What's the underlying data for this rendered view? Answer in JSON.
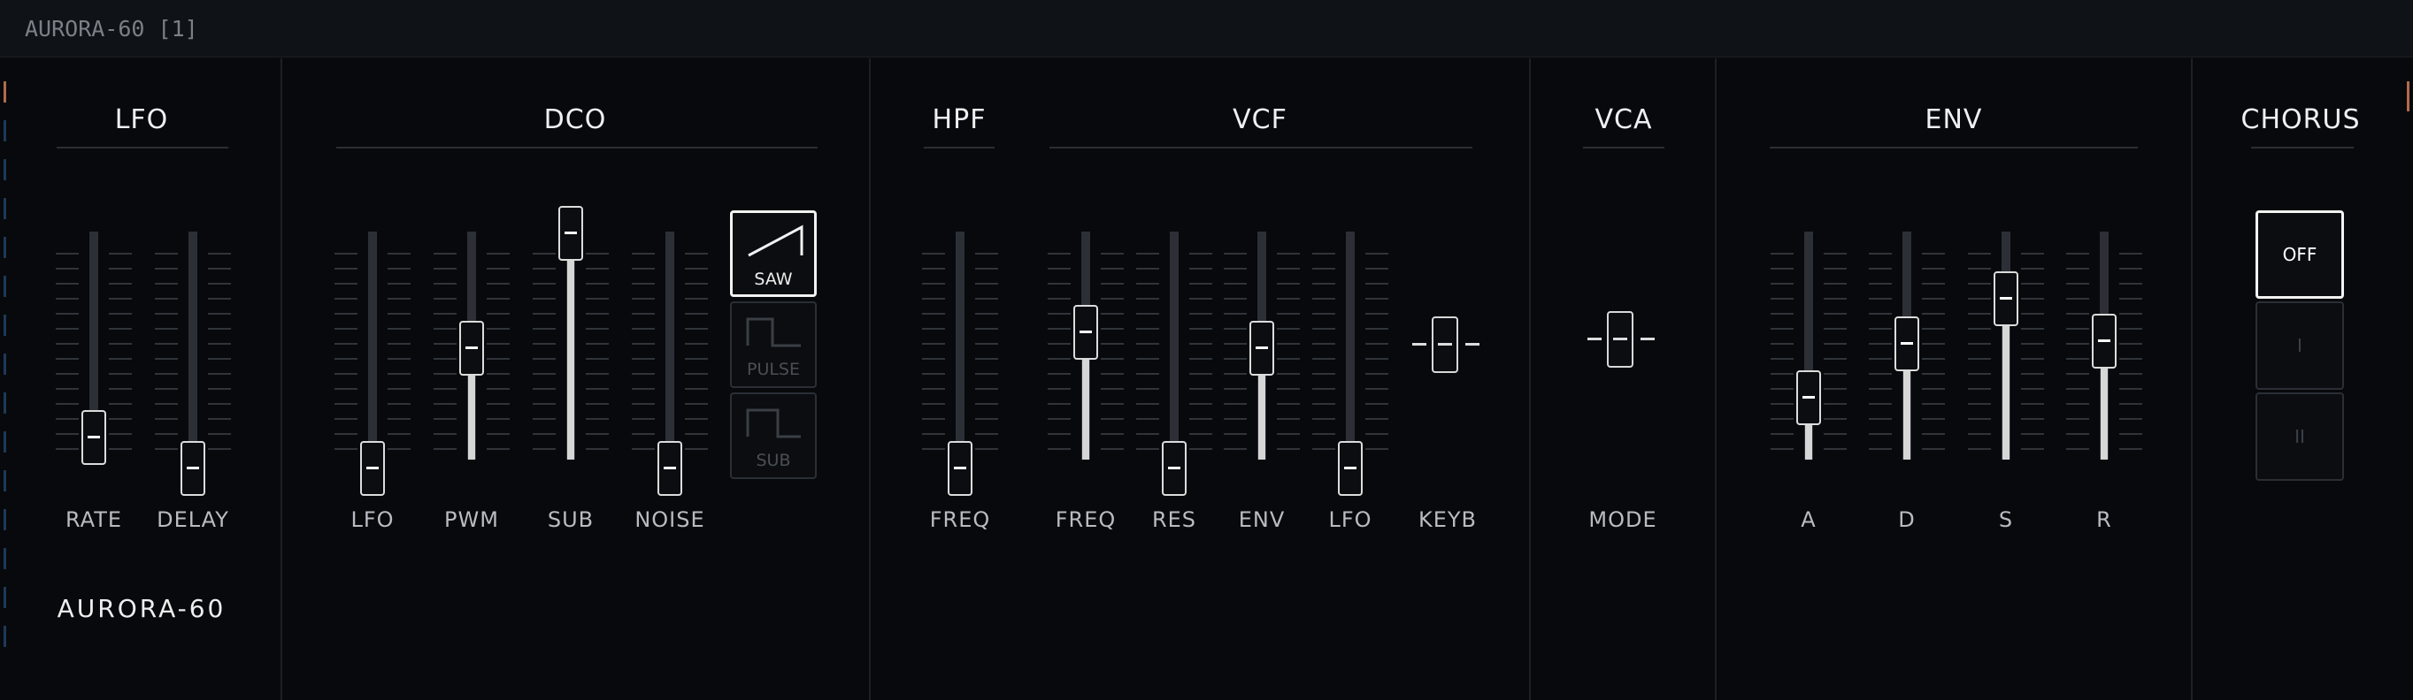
{
  "window": {
    "title": "AURORA-60 [1]"
  },
  "brand": "AURORA-60",
  "sections": {
    "lfo": "LFO",
    "dco": "DCO",
    "hpf": "HPF",
    "vcf": "VCF",
    "vca": "VCA",
    "env": "ENV",
    "chorus": "CHORUS"
  },
  "labels": {
    "rate": "RATE",
    "delay": "DELAY",
    "dco_lfo": "LFO",
    "pwm": "PWM",
    "sub": "SUB",
    "noise": "NOISE",
    "hpf_freq": "FREQ",
    "vcf_freq": "FREQ",
    "res": "RES",
    "env": "ENV",
    "vcf_lfo": "LFO",
    "keyb": "KEYB",
    "mode": "MODE",
    "a": "A",
    "d": "D",
    "s": "S",
    "r": "R"
  },
  "faders": {
    "rate": 0.13,
    "delay": 0.0,
    "dco_lfo": 0.0,
    "pwm": 0.51,
    "sub": 1.0,
    "noise": 0.0,
    "hpf_freq": 0.0,
    "vcf_freq": 0.58,
    "res": 0.0,
    "env": 0.51,
    "vcf_lfo": 0.0,
    "a": 0.3,
    "d": 0.53,
    "s": 0.72,
    "r": 0.54
  },
  "waveforms": {
    "saw": {
      "label": "SAW",
      "active": true
    },
    "pulse": {
      "label": "PULSE",
      "active": false
    },
    "sub": {
      "label": "SUB",
      "active": false
    }
  },
  "chorus": {
    "off": {
      "label": "OFF",
      "active": true
    },
    "one": {
      "label": "I",
      "active": false
    },
    "two": {
      "label": "II",
      "active": false
    }
  },
  "switches": {
    "keyb": "middle",
    "mode": "middle"
  }
}
